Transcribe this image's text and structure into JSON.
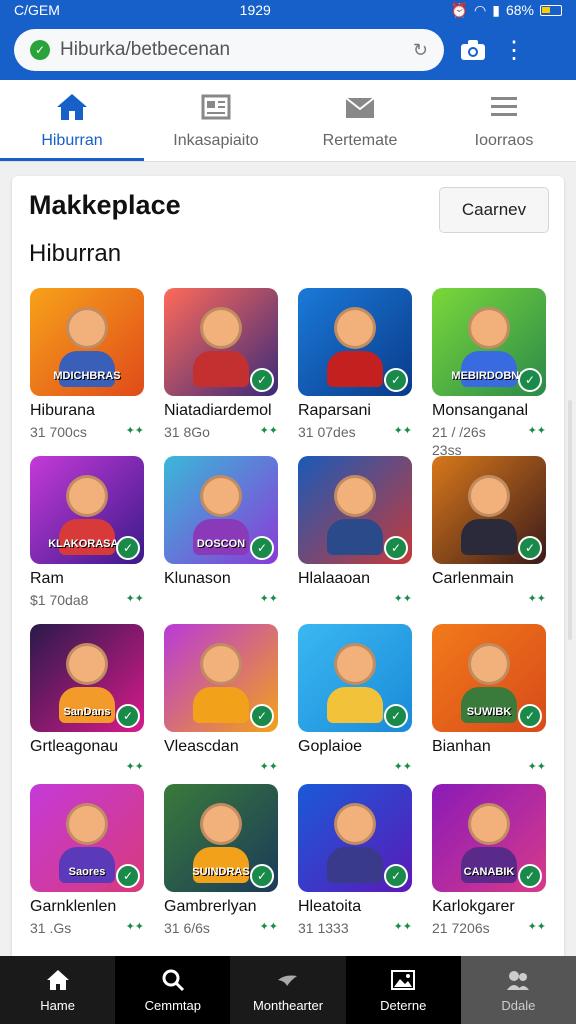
{
  "status_bar": {
    "carrier": "C/GEM",
    "time": "1929",
    "battery": "68%"
  },
  "url_bar": {
    "url": "Hiburka/betbecenan"
  },
  "top_tabs": [
    {
      "label": "Hiburran",
      "icon": "home-icon",
      "active": true
    },
    {
      "label": "Inkasapiaito",
      "icon": "news-icon",
      "active": false
    },
    {
      "label": "Rertemate",
      "icon": "mail-icon",
      "active": false
    },
    {
      "label": "Ioorraos",
      "icon": "menu-icon",
      "active": false
    }
  ],
  "card": {
    "title": "Makkeplace",
    "button": "Caarnev",
    "section": "Hiburran"
  },
  "apps": [
    {
      "name": "Hiburana",
      "meta": "31 700cs",
      "extra": "",
      "banner": "MDICHBRAS",
      "colors": [
        "#f7a21a",
        "#e04a1a"
      ],
      "body": "#3a5fb8"
    },
    {
      "name": "Niatadiardemol",
      "meta": "31 8Go",
      "extra": "",
      "banner": "",
      "colors": [
        "#ff6a5a",
        "#3a2a7a"
      ],
      "body": "#c43030"
    },
    {
      "name": "Raparsani",
      "meta": "31 07des",
      "extra": "",
      "banner": "",
      "colors": [
        "#1a7ad8",
        "#0a3a8a"
      ],
      "body": "#c42020"
    },
    {
      "name": "Monsanganal",
      "meta": "21 / /26s",
      "extra": "23ss",
      "banner": "MEBIRDOBNS",
      "colors": [
        "#7ad83a",
        "#2a8a4a"
      ],
      "body": "#3a6ae0"
    },
    {
      "name": "Ram",
      "meta": "$1 70da8",
      "extra": "",
      "banner": "KLAKORASAS",
      "colors": [
        "#c43ad8",
        "#3a1a8a"
      ],
      "body": "#d83a3a"
    },
    {
      "name": "Klunason",
      "meta": "",
      "extra": "",
      "banner": "DOSCON",
      "colors": [
        "#3ab8d8",
        "#8a3ad8"
      ],
      "body": "#8a3ab8"
    },
    {
      "name": "Hlalaaoan",
      "meta": "",
      "extra": "",
      "banner": "",
      "colors": [
        "#1a5ab8",
        "#c43a3a"
      ],
      "body": "#2a4a8a"
    },
    {
      "name": "Carlenmain",
      "meta": "",
      "extra": "",
      "banner": "",
      "colors": [
        "#d8781a",
        "#3a1a1a"
      ],
      "body": "#2a2a3a"
    },
    {
      "name": "Grtleagonau",
      "meta": "",
      "extra": "",
      "banner": "SanDans",
      "colors": [
        "#2a1a4a",
        "#d81a8a"
      ],
      "body": "#f29a2a"
    },
    {
      "name": "Vleascdan",
      "meta": "",
      "extra": "",
      "banner": "",
      "colors": [
        "#b83ad8",
        "#f2a21a"
      ],
      "body": "#f2a21a"
    },
    {
      "name": "Goplaioe",
      "meta": "",
      "extra": "",
      "banner": "",
      "colors": [
        "#3ab8f2",
        "#1a8ad8"
      ],
      "body": "#f2c23a"
    },
    {
      "name": "Bianhan",
      "meta": "",
      "extra": "",
      "banner": "SUWIBK",
      "colors": [
        "#f27a1a",
        "#d84a1a"
      ],
      "body": "#3a7a3a"
    },
    {
      "name": "Garnklenlen",
      "meta": "31 .Gs",
      "extra": "",
      "banner": "Saores",
      "colors": [
        "#c43ad8",
        "#d83a7a"
      ],
      "body": "#5a3ab8"
    },
    {
      "name": "Gambrerlyan",
      "meta": "31 6/6s",
      "extra": "",
      "banner": "SUINDRAS",
      "colors": [
        "#3a7a3a",
        "#1a3a5a"
      ],
      "body": "#f2a21a"
    },
    {
      "name": "Hleatoita",
      "meta": "31 1333",
      "extra": "",
      "banner": "",
      "colors": [
        "#1a5ad8",
        "#5a1ab8"
      ],
      "body": "#3a3a8a"
    },
    {
      "name": "Karlokgarer",
      "meta": "21 7206s",
      "extra": "",
      "banner": "CANABIK",
      "colors": [
        "#8a1ab8",
        "#d83a8a"
      ],
      "body": "#5a2a8a"
    }
  ],
  "bottom_nav": [
    {
      "label": "Hame",
      "icon": "home-icon"
    },
    {
      "label": "Cemmtap",
      "icon": "search-icon"
    },
    {
      "label": "Monthearter",
      "icon": "bird-icon"
    },
    {
      "label": "Deterne",
      "icon": "image-icon"
    },
    {
      "label": "Ddale",
      "icon": "profile-icon"
    }
  ]
}
